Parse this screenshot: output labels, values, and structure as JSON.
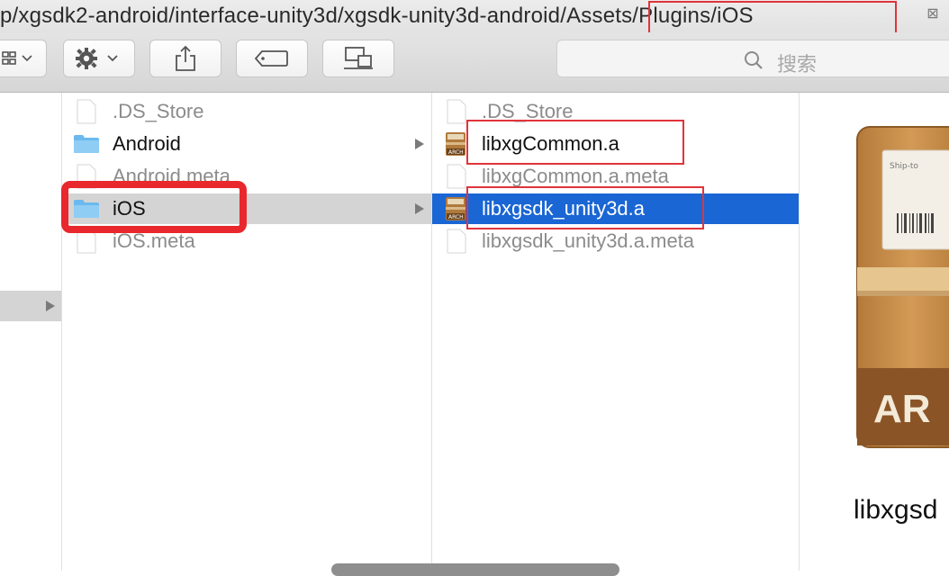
{
  "window": {
    "path_text": "p/xgsdk2-android/interface-unity3d/xgsdk-unity3d-android/Assets/Plugins/iOS",
    "close_glyph": "⊠"
  },
  "toolbar": {
    "search_placeholder": "搜索",
    "icons": [
      "view-grid-icon",
      "gear-icon",
      "share-icon",
      "tag-icon",
      "device-icon",
      "search-icon"
    ]
  },
  "columns": {
    "col1": {
      "items": [
        {
          "label": ".DS_Store",
          "kind": "file",
          "dim": true
        },
        {
          "label": "Android",
          "kind": "folder",
          "dim": false,
          "has_children": true
        },
        {
          "label": "Android.meta",
          "kind": "file",
          "dim": true
        },
        {
          "label": "iOS",
          "kind": "folder",
          "dim": false,
          "has_children": true,
          "selected": true
        },
        {
          "label": "iOS.meta",
          "kind": "file",
          "dim": true
        }
      ]
    },
    "col2": {
      "items": [
        {
          "label": ".DS_Store",
          "kind": "file",
          "dim": true
        },
        {
          "label": "libxgCommon.a",
          "kind": "archive",
          "dim": false
        },
        {
          "label": "libxgCommon.a.meta",
          "kind": "file",
          "dim": true
        },
        {
          "label": "libxgsdk_unity3d.a",
          "kind": "archive",
          "dim": false,
          "selected": true
        },
        {
          "label": "libxgsdk_unity3d.a.meta",
          "kind": "file",
          "dim": true
        }
      ]
    }
  },
  "preview": {
    "name": "libxgsd",
    "arch_label": "AR",
    "ship_label": "Ship-to"
  },
  "colors": {
    "selection_blue": "#1a66d4",
    "highlight_red": "#e0343a"
  }
}
